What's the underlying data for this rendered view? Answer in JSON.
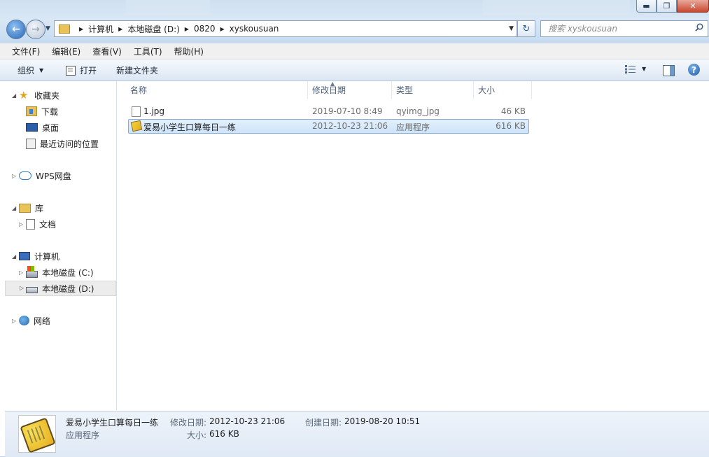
{
  "window": {
    "controls": {
      "minimize": "▬",
      "maximize": "❐",
      "close": "✕"
    }
  },
  "address": {
    "breadcrumbs": [
      "计算机",
      "本地磁盘 (D:)",
      "0820",
      "xyskousuan"
    ]
  },
  "search": {
    "placeholder": "搜索 xyskousuan"
  },
  "menu": [
    "文件(F)",
    "编辑(E)",
    "查看(V)",
    "工具(T)",
    "帮助(H)"
  ],
  "toolbar": {
    "organize": "组织",
    "open": "打开",
    "new_folder": "新建文件夹"
  },
  "nav": {
    "favorites": "收藏夹",
    "downloads": "下载",
    "desktop": "桌面",
    "recent": "最近访问的位置",
    "wps": "WPS网盘",
    "libraries": "库",
    "documents": "文档",
    "computer": "计算机",
    "drive_c": "本地磁盘 (C:)",
    "drive_d": "本地磁盘 (D:)",
    "network": "网络"
  },
  "columns": {
    "name": "名称",
    "date": "修改日期",
    "type": "类型",
    "size": "大小"
  },
  "files": [
    {
      "name": "1.jpg",
      "date": "2019-07-10 8:49",
      "type": "qyimg_jpg",
      "size": "46 KB"
    },
    {
      "name": "爱易小学生口算每日一练",
      "date": "2012-10-23 21:06",
      "type": "应用程序",
      "size": "616 KB"
    }
  ],
  "details": {
    "name": "爱易小学生口算每日一练",
    "kind": "应用程序",
    "modified_label": "修改日期:",
    "modified_value": "2012-10-23 21:06",
    "created_label": "创建日期:",
    "created_value": "2019-08-20 10:51",
    "size_label": "大小:",
    "size_value": "616 KB"
  },
  "colors": {
    "accent": "#2a66b4",
    "selection": "#cde4fa",
    "frame": "#cfe0f1"
  }
}
